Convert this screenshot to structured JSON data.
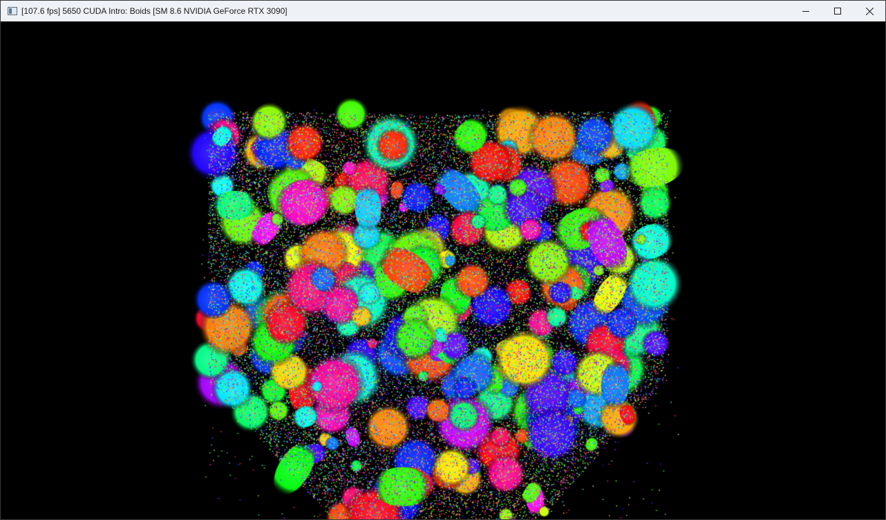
{
  "window": {
    "title": "[107.6 fps] 5650 CUDA Intro: Boids [SM 8.6 NVIDIA GeForce RTX 3090]",
    "icon": "app-window-icon",
    "controls": {
      "minimize_icon": "minimize-icon",
      "maximize_icon": "maximize-icon",
      "close_icon": "close-icon"
    }
  },
  "scene": {
    "background": "#000000",
    "description_colors": [
      "#ff2a2a",
      "#2aff2a",
      "#2a2aff",
      "#ffff2a",
      "#ff2aff",
      "#2affff",
      "#ff8a2a",
      "#8aff2a"
    ]
  }
}
